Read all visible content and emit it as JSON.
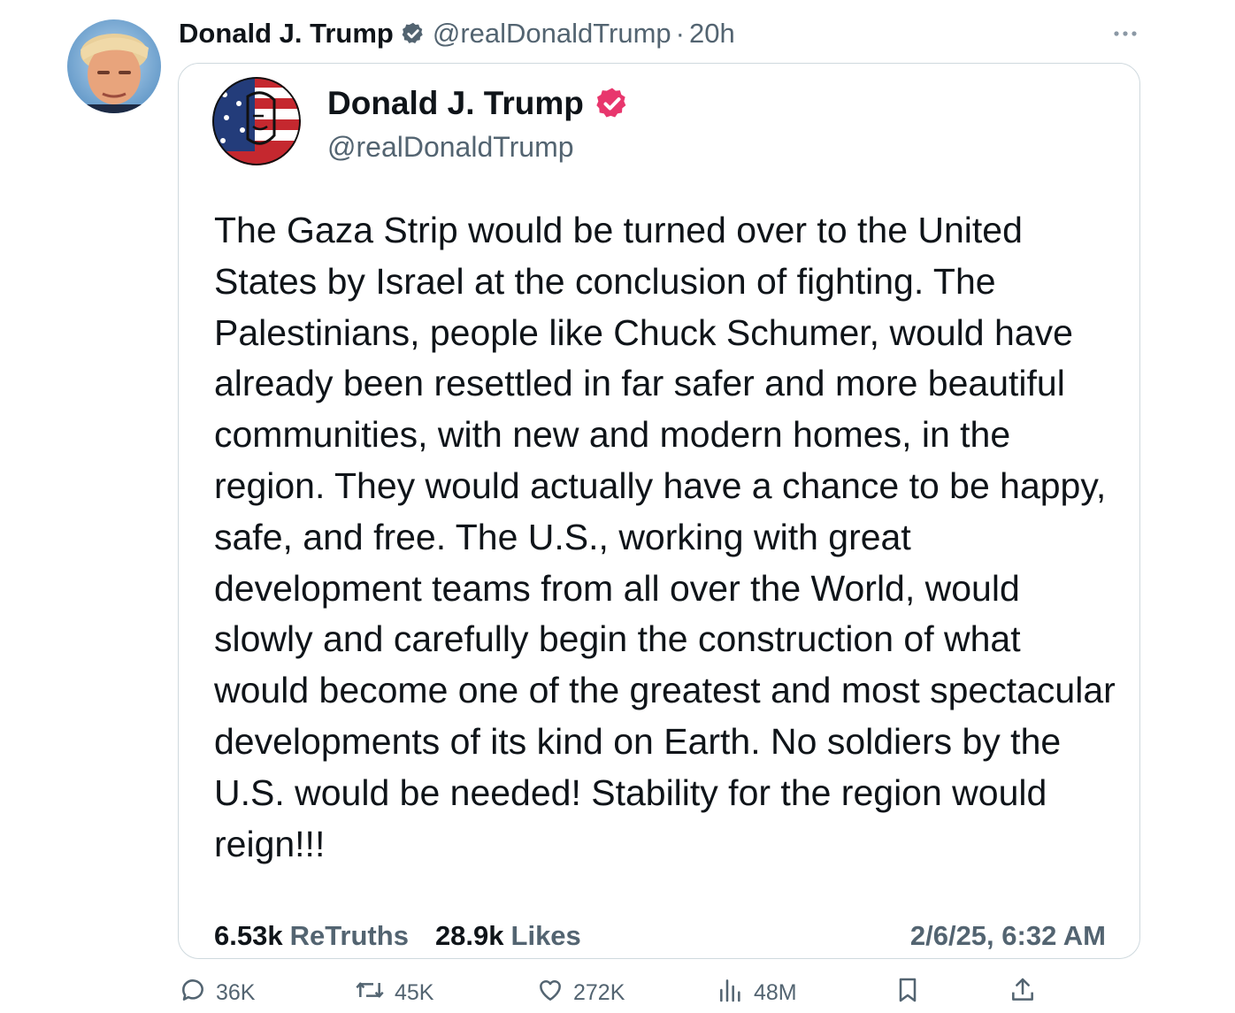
{
  "header": {
    "name": "Donald J. Trump",
    "handle": "@realDonaldTrump",
    "separator": "·",
    "time": "20h"
  },
  "embedded_post": {
    "name": "Donald J. Trump",
    "handle": "@realDonaldTrump",
    "text": "The Gaza Strip would be turned over to the United States by Israel at the conclusion of fighting. The Palestinians, people like Chuck Schumer, would have already been resettled in far safer and more beautiful communities, with new and modern homes, in the region. They would actually have a chance to be happy, safe, and free. The U.S., working with great development teams from all over the World, would slowly and carefully begin the construction of what would become one of the greatest and most spectacular developments of its kind on Earth. No soldiers by the U.S. would be needed! Stability for the region would reign!!!",
    "retruths_count": "6.53k",
    "retruths_label": "ReTruths",
    "likes_count": "28.9k",
    "likes_label": "Likes",
    "date": "2/6/25, 6:32 AM"
  },
  "actions": {
    "replies": "36K",
    "reposts": "45K",
    "likes": "272K",
    "views": "48M"
  },
  "colors": {
    "text": "#0f1419",
    "secondary": "#536471",
    "verified_blue": "#536471",
    "truth_badge": "#e8366d",
    "border": "#cfd9de"
  },
  "icons": {
    "more": "more-icon",
    "verified": "verified-badge-icon",
    "reply": "reply-icon",
    "repost": "repost-icon",
    "like": "heart-icon",
    "views": "views-icon",
    "bookmark": "bookmark-icon",
    "share": "share-icon"
  }
}
